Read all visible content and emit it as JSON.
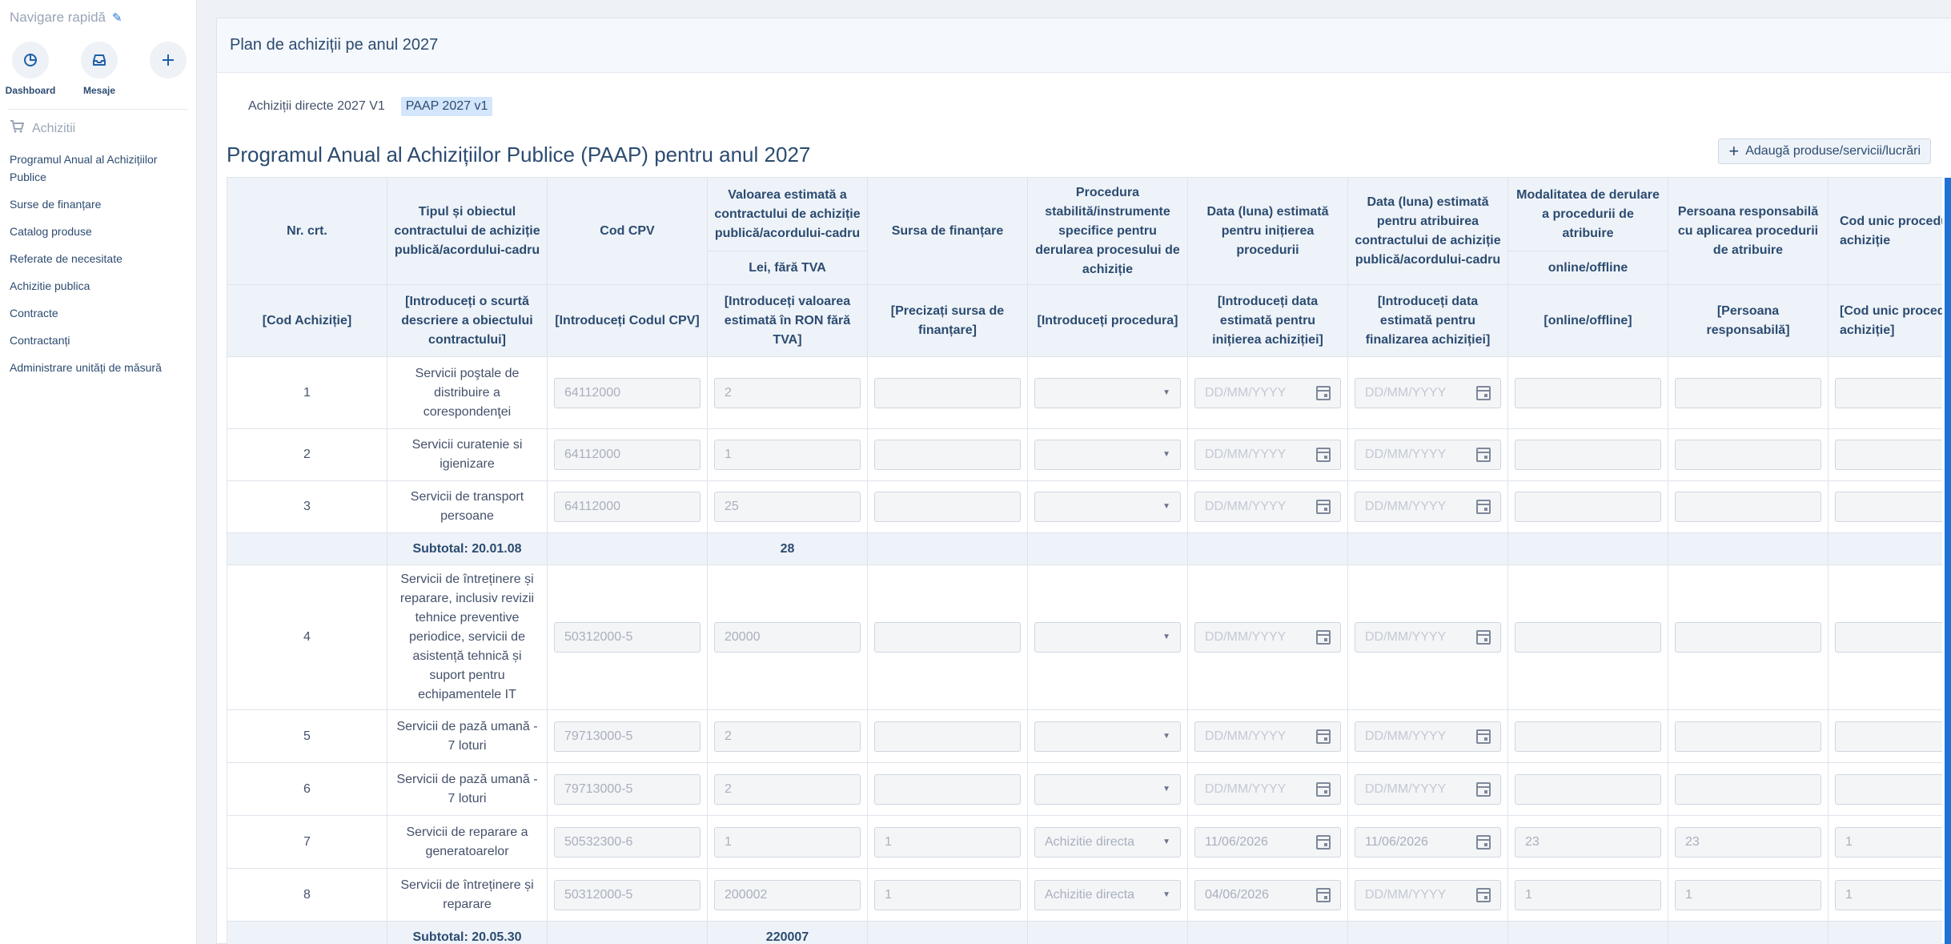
{
  "sidebar": {
    "quick_title": "Navigare rapidă",
    "quick_items": [
      {
        "label": "Dashboard",
        "icon": "chart-pie-icon"
      },
      {
        "label": "Mesaje",
        "icon": "inbox-icon"
      },
      {
        "label": "",
        "icon": "plus-icon"
      }
    ],
    "section": "Achizitii",
    "items": [
      "Programul Anual al Achizițiilor Publice",
      "Surse de finanțare",
      "Catalog produse",
      "Referate de necesitate",
      "Achizitie publica",
      "Contracte",
      "Contractanți",
      "Administrare unități de măsură"
    ]
  },
  "main": {
    "card_title": "Plan de achiziții pe anul 2027",
    "tabs": [
      "Achiziții directe 2027 V1",
      "PAAP 2027 v1"
    ],
    "page_title": "Programul Anual al Achizițiilor Publice (PAAP) pentru anul 2027",
    "add_button": "Adaugă produse/servicii/lucrări"
  },
  "table": {
    "headers": {
      "nr": "Nr. crt.",
      "tip": "Tipul și obiectul contractului de achiziție publică/acordului-cadru",
      "cpv": "Cod CPV",
      "valoare": "Valoarea estimată a contractului de achiziție publică/acordului-cadru",
      "valoare_sub": "Lei, fără TVA",
      "sursa": "Sursa de finanțare",
      "procedura": "Procedura stabilită/instrumente specifice pentru derularea procesului de achiziție",
      "data_init": "Data (luna) estimată pentru inițierea procedurii",
      "data_atrib": "Data (luna) estimată pentru atribuirea contractului de achiziție publică/acordului-cadru",
      "modalitate": "Modalitatea de derulare a procedurii de atribuire",
      "modalitate_sub": "online/offline",
      "persoana": "Persoana responsabilă cu aplicarea procedurii de atribuire",
      "cod_unic": "Cod unic procedură achiziție"
    },
    "hints": {
      "nr": "[Cod Achiziție]",
      "tip": "[Introduceți o scurtă descriere a obiectului contractului]",
      "cpv": "[Introduceți Codul CPV]",
      "valoare": "[Introduceți valoarea estimată în RON fără TVA]",
      "sursa": "[Precizați sursa de finanțare]",
      "procedura": "[Introduceți procedura]",
      "data_init": "[Introduceți data estimată pentru inițierea achiziției]",
      "data_atrib": "[Introduceți data estimată pentru finalizarea achiziției]",
      "modalitate": "[online/offline]",
      "persoana": "[Persoana responsabilă]",
      "cod_unic": "[Cod unic procedură achiziție]"
    },
    "date_placeholder": "DD/MM/YYYY",
    "rows": [
      {
        "type": "row",
        "nr": "1",
        "tip": "Servicii poştale de distribuire a corespondenţei",
        "cpv": "64112000",
        "valoare": "2",
        "sursa": "",
        "procedura": "",
        "data_init": "",
        "data_atrib": "",
        "modalitate": "",
        "persoana": "",
        "cod": ""
      },
      {
        "type": "row",
        "nr": "2",
        "tip": "Servicii curatenie si igienizare",
        "cpv": "64112000",
        "valoare": "1",
        "sursa": "",
        "procedura": "",
        "data_init": "",
        "data_atrib": "",
        "modalitate": "",
        "persoana": "",
        "cod": ""
      },
      {
        "type": "row",
        "nr": "3",
        "tip": "Servicii de transport persoane",
        "cpv": "64112000",
        "valoare": "25",
        "sursa": "",
        "procedura": "",
        "data_init": "",
        "data_atrib": "",
        "modalitate": "",
        "persoana": "",
        "cod": ""
      },
      {
        "type": "subtotal",
        "label": "Subtotal: 20.01.08",
        "value": "28"
      },
      {
        "type": "row",
        "nr": "4",
        "tip": "Servicii de întreținere și reparare, inclusiv revizii tehnice preventive periodice, servicii de asistență tehnică și suport pentru echipamentele IT",
        "cpv": "50312000-5",
        "valoare": "20000",
        "sursa": "",
        "procedura": "",
        "data_init": "",
        "data_atrib": "",
        "modalitate": "",
        "persoana": "",
        "cod": ""
      },
      {
        "type": "row",
        "nr": "5",
        "tip": "Servicii de pază umană - 7 loturi",
        "cpv": "79713000-5",
        "valoare": "2",
        "sursa": "",
        "procedura": "",
        "data_init": "",
        "data_atrib": "",
        "modalitate": "",
        "persoana": "",
        "cod": ""
      },
      {
        "type": "row",
        "nr": "6",
        "tip": "Servicii de pază umană - 7 loturi",
        "cpv": "79713000-5",
        "valoare": "2",
        "sursa": "",
        "procedura": "",
        "data_init": "",
        "data_atrib": "",
        "modalitate": "",
        "persoana": "",
        "cod": ""
      },
      {
        "type": "row",
        "nr": "7",
        "tip": "Servicii de reparare a generatoarelor",
        "cpv": "50532300-6",
        "valoare": "1",
        "sursa": "1",
        "procedura": "Achizitie directa",
        "data_init": "11/06/2026",
        "data_atrib": "11/06/2026",
        "modalitate": "23",
        "persoana": "23",
        "cod": "1"
      },
      {
        "type": "row",
        "nr": "8",
        "tip": "Servicii de întreținere și reparare",
        "cpv": "50312000-5",
        "valoare": "200002",
        "sursa": "1",
        "procedura": "Achizitie directa",
        "data_init": "04/06/2026",
        "data_atrib": "",
        "modalitate": "1",
        "persoana": "1",
        "cod": "1"
      },
      {
        "type": "subtotal",
        "label": "Subtotal: 20.05.30",
        "value": "220007"
      }
    ]
  }
}
